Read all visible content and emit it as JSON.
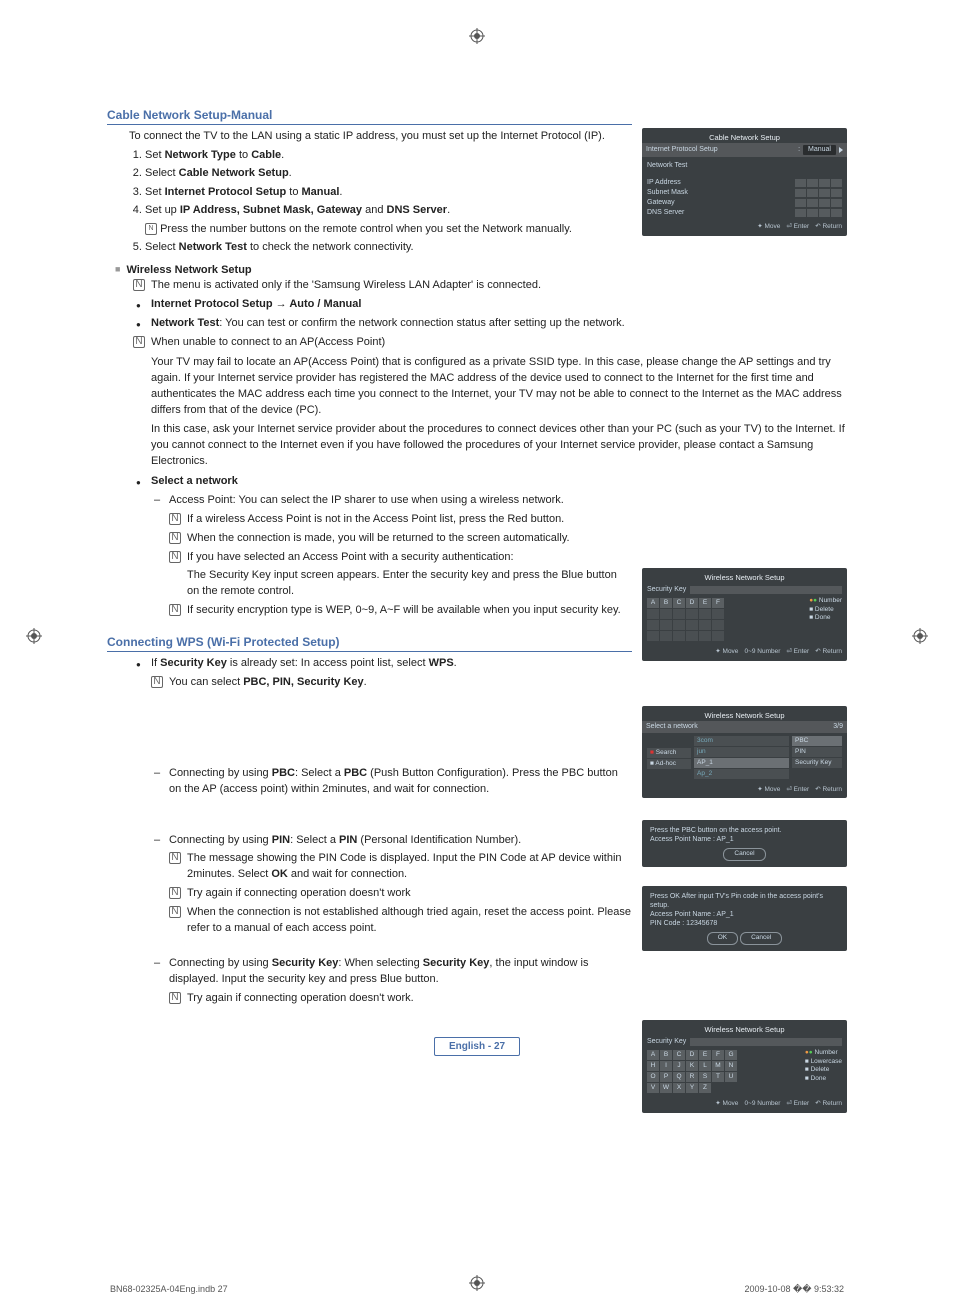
{
  "header": {
    "title": "Cable Network Setup-Manual",
    "intro": "To connect the TV to the LAN using a static IP address, you must set up the Internet Protocol (IP)."
  },
  "steps": {
    "s1a": "Set ",
    "s1b": "Network Type",
    "s1c": " to ",
    "s1d": "Cable",
    "s1e": ".",
    "s2a": "Select ",
    "s2b": "Cable Network Setup",
    "s2c": ".",
    "s3a": "Set ",
    "s3b": "Internet Protocol Setup",
    "s3c": " to ",
    "s3d": "Manual",
    "s3e": ".",
    "s4a": "Set up ",
    "s4b": "IP Address, Subnet Mask, Gateway",
    "s4c": " and ",
    "s4d": "DNS Server",
    "s4e": ".",
    "s4note": "Press the number buttons on the remote control when you set the Network manually.",
    "s5a": "Select ",
    "s5b": "Network Test",
    "s5c": " to check the network connectivity."
  },
  "wireless": {
    "heading": "Wireless Network Setup",
    "n1": "The menu is activated only if the 'Samsung Wireless LAN Adapter' is connected.",
    "n2a": "Internet Protocol Setup → Auto / Manual",
    "n3a": "Network Test",
    "n3b": ": You can test or confirm the network connection status after setting up the network.",
    "n4": "When unable to connect to an AP(Access Point)",
    "p1": "Your TV may fail to locate an AP(Access Point) that is configured as a private SSID type. In this case, please change the AP settings and try again. If your Internet service provider has registered the MAC address of the device used to connect to the Internet for the first time and authenticates the MAC address each time you connect to the Internet, your TV may not be able to connect to the Internet as the MAC address differs from that of the device (PC).",
    "p2": "In this case, ask your Internet service provider about the procedures to connect devices other than your PC (such as your TV) to the Internet. If you cannot connect to the Internet even if you have followed the procedures of your Internet service provider, please contact a Samsung Electronics.",
    "sel_net": "Select a network",
    "sn1": "Access Point: You can select the IP sharer to use when using a wireless network.",
    "sn1a": "If a wireless Access Point is not in the Access Point list, press the Red button.",
    "sn1b": "When the connection is made, you will be returned to the screen automatically.",
    "sn1c": "If you have selected an Access Point with a security authentication:",
    "sn1c2": "The Security Key input screen appears. Enter the security key and press the Blue button on the remote control.",
    "sn1d": "If security encryption type is WEP, 0~9, A~F will be available when you input security key."
  },
  "wps": {
    "heading": "Connecting WPS (Wi-Fi Protected Setup)",
    "b1a": "If ",
    "b1b": "Security Key",
    "b1c": " is already set: In access point list, select ",
    "b1d": "WPS",
    "b1e": ".",
    "b1n": "You can select ",
    "b1n2": "PBC, PIN, Security Key",
    "b1n3": ".",
    "pbc1": "Connecting by using ",
    "pbc2": "PBC",
    "pbc3": ": Select a ",
    "pbc4": "PBC",
    "pbc5": " (Push Button Configuration). Press the PBC button on the AP (access point) within 2minutes, and wait for connection.",
    "pin1": "Connecting by using ",
    "pin2": "PIN",
    "pin3": ": Select a ",
    "pin4": "PIN",
    "pin5": " (Personal Identification Number).",
    "pin_n1": "The message showing the PIN Code is displayed. Input the PIN Code at AP device within 2minutes. Select ",
    "pin_n1b": "OK",
    "pin_n1c": " and wait for connection.",
    "pin_n2": "Try again if connecting operation doesn't work",
    "pin_n3": "When the connection is not established although tried again, reset the access point. Please refer to a manual of each access point.",
    "sk1": "Connecting by using ",
    "sk2": "Security Key",
    "sk3": ": When selecting ",
    "sk4": "Security Key",
    "sk5": ", the input window is displayed. Input the security key and press Blue button.",
    "sk_n1": "Try again if connecting operation doesn't work."
  },
  "sidebar": {
    "box1": {
      "title": "Cable Network Setup",
      "row1_label": "Internet Protocol Setup",
      "row1_val": "Manual",
      "row2": "Network Test",
      "f1": "IP Address",
      "f2": "Subnet Mask",
      "f3": "Gateway",
      "f4": "DNS Server",
      "ft_move": "Move",
      "ft_enter": "Enter",
      "ft_return": "Return"
    },
    "box2": {
      "title": "Wireless Network Setup",
      "sec_key": "Security Key",
      "keys": [
        "A",
        "B",
        "C",
        "D",
        "E",
        "F"
      ],
      "side1": "Number",
      "side2": "Delete",
      "side3": "Done",
      "ft_move": "Move",
      "ft_num": "Number",
      "ft_enter": "Enter",
      "ft_return": "Return",
      "num_range": "0~9"
    },
    "box3": {
      "title": "Wireless Network Setup",
      "sel": "Select a network",
      "count": "3/9",
      "search": "Search",
      "adhoc": "Ad-hoc",
      "nets": [
        "3com",
        "jun",
        "AP_1",
        "Ap_2"
      ],
      "opt1": "PBC",
      "opt2": "PIN",
      "opt3": "Security Key",
      "ft_move": "Move",
      "ft_enter": "Enter",
      "ft_return": "Return"
    },
    "box4": {
      "l1": "Press the PBC button on the access point.",
      "l2": "Access Point Name : AP_1",
      "cancel": "Cancel"
    },
    "box5": {
      "l1": "Press OK After input TV's Pin code in the access point's setup.",
      "l2": "Access Point Name : AP_1",
      "l3": "PIN Code : 12345678",
      "ok": "OK",
      "cancel": "Cancel"
    },
    "box6": {
      "title": "Wireless Network Setup",
      "sec_key": "Security Key",
      "rows": [
        [
          "A",
          "B",
          "C",
          "D",
          "E",
          "F",
          "G"
        ],
        [
          "H",
          "I",
          "J",
          "K",
          "L",
          "M",
          "N"
        ],
        [
          "O",
          "P",
          "Q",
          "R",
          "S",
          "T",
          "U"
        ],
        [
          "V",
          "W",
          "X",
          "Y",
          "Z"
        ]
      ],
      "side1": "Number",
      "side2": "Lowercase",
      "side3": "Delete",
      "side4": "Done",
      "ft_move": "Move",
      "ft_num": "Number",
      "ft_enter": "Enter",
      "ft_return": "Return",
      "num_range": "0~9"
    }
  },
  "footer": {
    "lang": "English - 27",
    "left": "BN68-02325A-04Eng.indb   27",
    "right": "2009-10-08   �� 9:53:32"
  }
}
